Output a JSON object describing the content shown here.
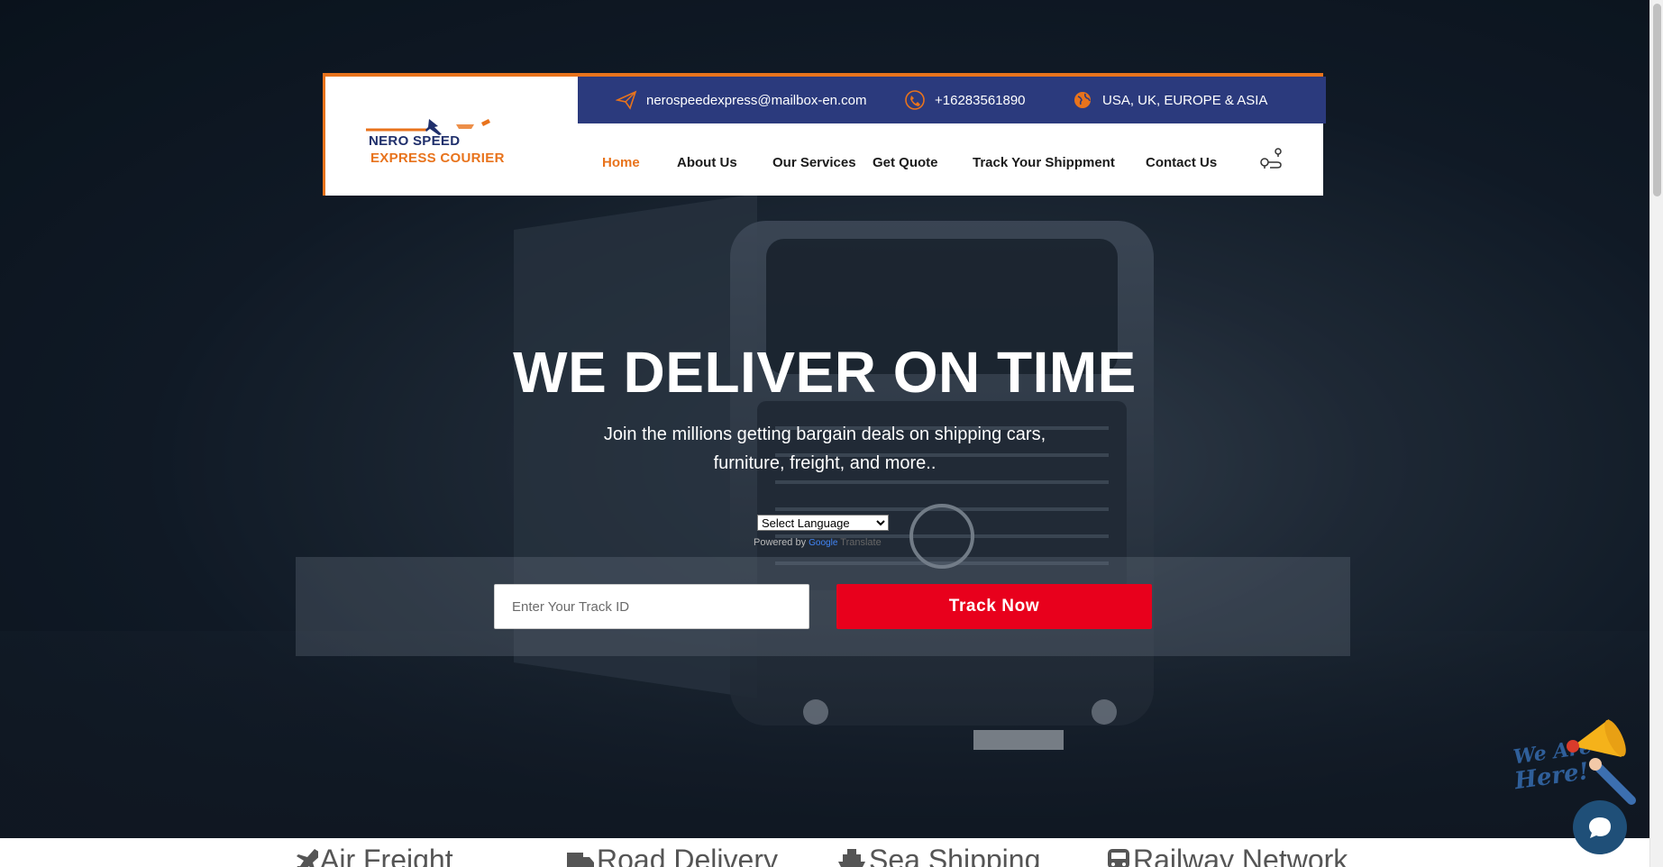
{
  "header": {
    "logo": {
      "line1": "NERO SPEED",
      "line2": "EXPRESS COURIER"
    },
    "topbar": {
      "email": "nerospeedexpress@mailbox-en.com",
      "phone": "+16283561890",
      "regions": "USA, UK, EUROPE & ASIA"
    },
    "nav": {
      "items": [
        "Home",
        "About Us",
        "Our Services",
        "Get Quote",
        "Track Your Shippment",
        "Contact Us"
      ],
      "active": "Home"
    }
  },
  "hero": {
    "title": "WE DELIVER ON TIME",
    "subtitle_line1": "Join the millions getting bargain deals on shipping cars,",
    "subtitle_line2": "furniture, freight, and more..",
    "language_select": "Select Language",
    "powered_by": "Powered by",
    "google": "Google",
    "translate": "Translate",
    "track_placeholder": "Enter Your Track ID",
    "track_button": "Track Now"
  },
  "services": [
    "Air Freight",
    "Road Delivery",
    "Sea Shipping",
    "Railway Network"
  ],
  "colors": {
    "accent": "#e8731c",
    "topbar": "#2b3a7d",
    "track_button": "#e8001c",
    "chat": "#1f4f78"
  },
  "icons": [
    "send-icon",
    "phone-icon",
    "globe-icon",
    "location-route-icon",
    "plane-icon",
    "truck-icon",
    "ship-icon",
    "train-icon",
    "chat-bubble-icon",
    "megaphone-icon"
  ]
}
